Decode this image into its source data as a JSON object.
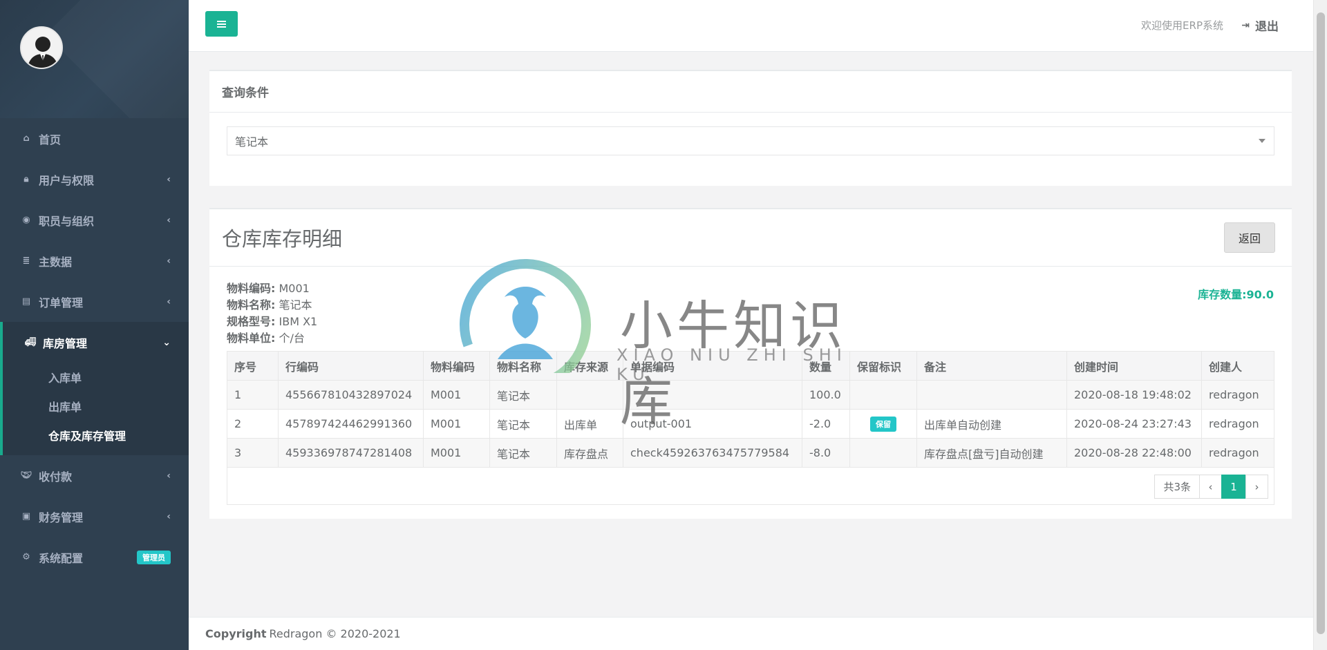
{
  "colors": {
    "sidebar_bg": "#2f4050",
    "accent": "#1ab394",
    "info_badge": "#23c6c8"
  },
  "sidebar": {
    "items": [
      {
        "label": "首页",
        "icon": "home-icon"
      },
      {
        "label": "用户与权限",
        "icon": "lock-icon"
      },
      {
        "label": "职员与组织",
        "icon": "user-circle-icon"
      },
      {
        "label": "主数据",
        "icon": "database-icon"
      },
      {
        "label": "订单管理",
        "icon": "list-alt-icon"
      },
      {
        "label": "库房管理",
        "icon": "truck-icon"
      },
      {
        "label": "收付款",
        "icon": "handshake-icon"
      },
      {
        "label": "财务管理",
        "icon": "money-icon"
      },
      {
        "label": "系统配置",
        "icon": "gear-icon",
        "badge": "管理员"
      }
    ],
    "submenu": [
      "入库单",
      "出库单",
      "仓库及库存管理"
    ]
  },
  "header": {
    "welcome": "欢迎使用ERP系统",
    "logout": "退出"
  },
  "query": {
    "title": "查询条件",
    "selected": "笔记本"
  },
  "detail": {
    "title": "仓库库存明细",
    "back_label": "返回",
    "info": [
      {
        "label": "物料编码:",
        "value": "M001"
      },
      {
        "label": "物料名称:",
        "value": "笔记本"
      },
      {
        "label": "规格型号:",
        "value": "IBM X1"
      },
      {
        "label": "物料单位:",
        "value": "个/台"
      }
    ],
    "stock_label": "库存数量:",
    "stock_value": "90.0"
  },
  "table": {
    "headers": [
      "序号",
      "行编码",
      "物料编码",
      "物料名称",
      "库存来源",
      "单据编码",
      "数量",
      "保留标识",
      "备注",
      "创建时间",
      "创建人"
    ],
    "rows": [
      [
        "1",
        "455667810432897024",
        "M001",
        "笔记本",
        "",
        "",
        "100.0",
        "",
        "",
        "2020-08-18 19:48:02",
        "redragon"
      ],
      [
        "2",
        "457897424462991360",
        "M001",
        "笔记本",
        "出库单",
        "output-001",
        "-2.0",
        "保留",
        "出库单自动创建",
        "2020-08-24 23:27:43",
        "redragon"
      ],
      [
        "3",
        "459336978747281408",
        "M001",
        "笔记本",
        "库存盘点",
        "check459263763475779584",
        "-8.0",
        "",
        "库存盘点[盘亏]自动创建",
        "2020-08-28 22:48:00",
        "redragon"
      ]
    ]
  },
  "pagination": {
    "total": "共3条",
    "prev": "‹",
    "current": "1",
    "next": "›"
  },
  "watermark": {
    "text": "小牛知识库",
    "sub": "XIAO NIU ZHI SHI KU"
  },
  "footer": {
    "brand": "Copyright",
    "text": "Redragon © 2020-2021"
  }
}
